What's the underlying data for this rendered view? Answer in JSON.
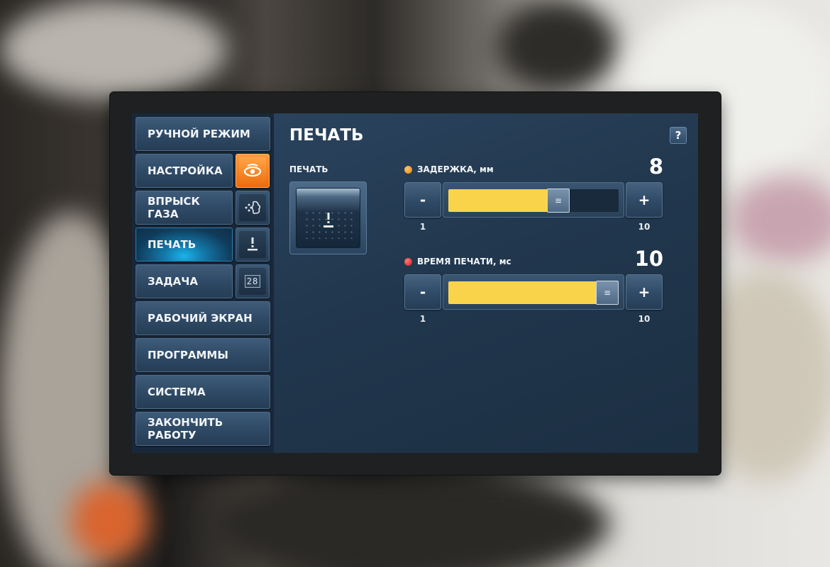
{
  "sidebar": {
    "items": [
      {
        "label": "РУЧНОЙ РЕЖИМ"
      },
      {
        "label": "НАСТРОЙКА",
        "icon": "eye-icon"
      },
      {
        "label": "ВПРЫСК ГАЗА",
        "icon": "gas-injection-icon"
      },
      {
        "label": "ПЕЧАТЬ",
        "icon": "stamp-icon",
        "active": true
      },
      {
        "label": "ЗАДАЧА",
        "icon": "counter-icon"
      },
      {
        "label": "РАБОЧИЙ ЭКРАН"
      },
      {
        "label": "ПРОГРАММЫ"
      },
      {
        "label": "СИСТЕМА"
      },
      {
        "label": "ЗАКОНЧИТЬ РАБОТУ"
      }
    ],
    "counter_icon_text": "28"
  },
  "main": {
    "title": "ПЕЧАТЬ",
    "help_label": "?",
    "print_label": "ПЕЧАТЬ",
    "params": [
      {
        "label": "ЗАДЕРЖКА, мм",
        "value": "8",
        "value_num": 8,
        "min": "1",
        "max": "10",
        "min_num": 1,
        "max_num": 10,
        "indicator_color": "#f39a1b",
        "minus_label": "-",
        "plus_label": "+"
      },
      {
        "label": "ВРЕМЯ ПЕЧАТИ, мс",
        "value": "10",
        "value_num": 10,
        "min": "1",
        "max": "10",
        "min_num": 1,
        "max_num": 10,
        "indicator_color": "#e02020",
        "minus_label": "-",
        "plus_label": "+"
      }
    ]
  },
  "colors": {
    "accent": "#f9d44a",
    "active_nav": "#1ab4ea",
    "highlight_icon": "#f08020"
  }
}
